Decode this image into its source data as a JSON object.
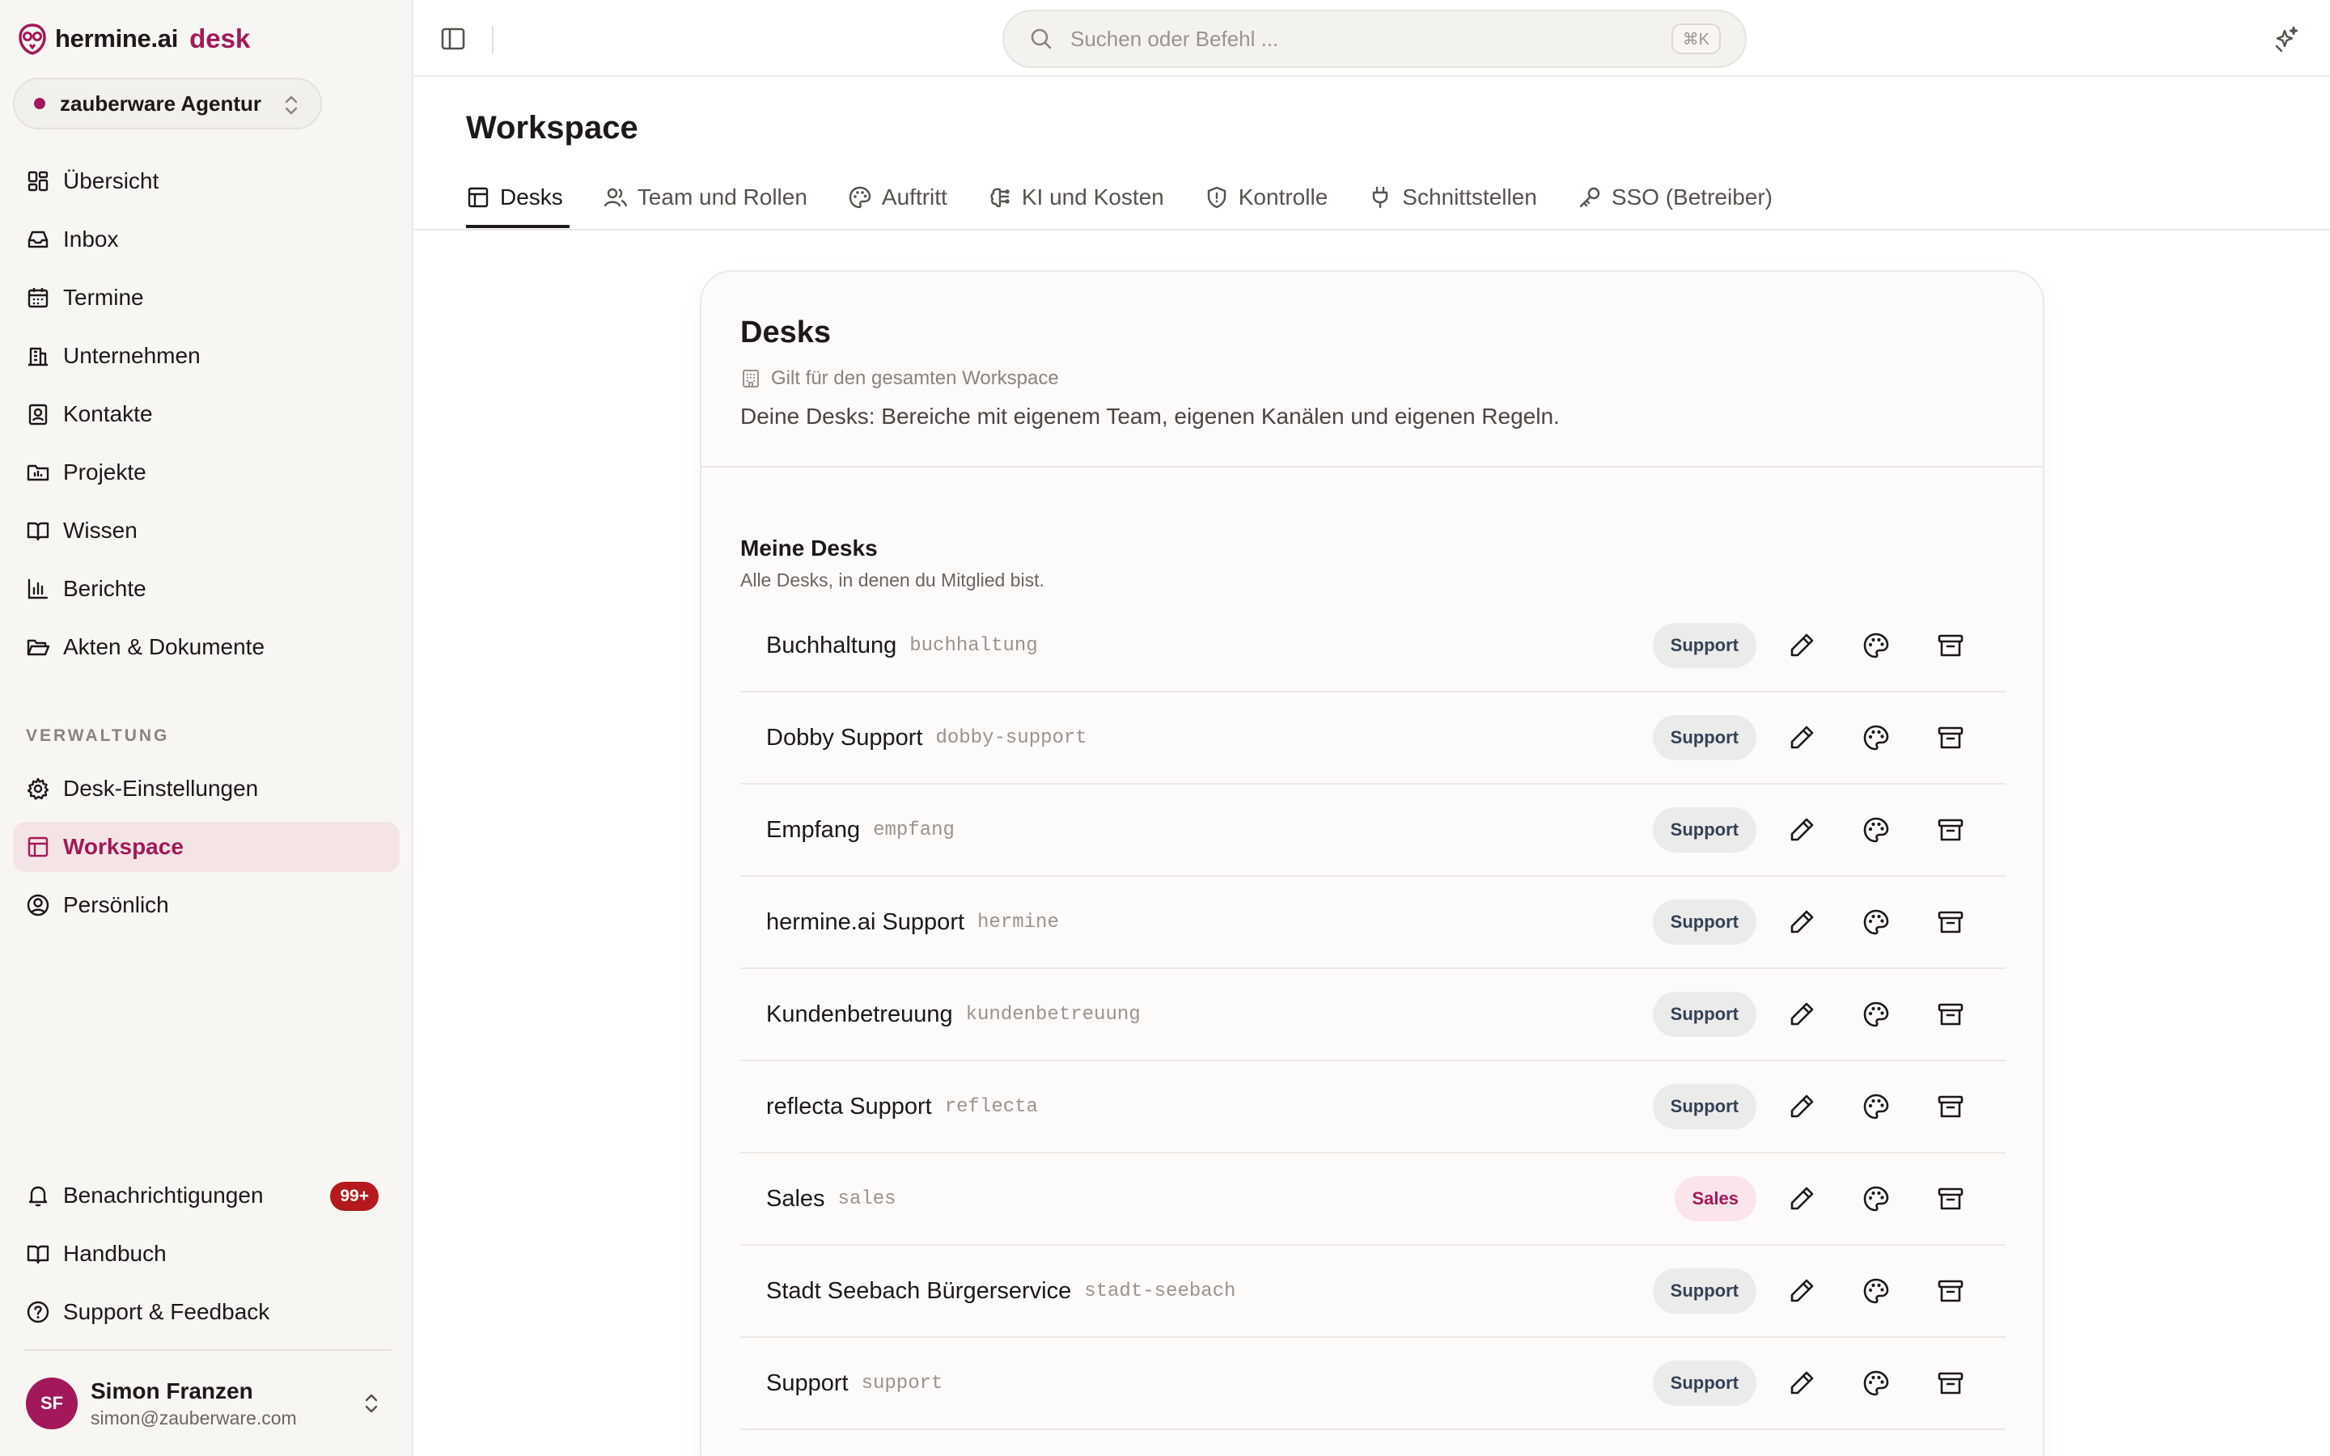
{
  "brand": {
    "name": "hermine.ai",
    "product": "desk"
  },
  "workspace_switcher": {
    "name": "zauberware Agentur"
  },
  "nav": {
    "main": [
      {
        "label": "Übersicht",
        "icon": "dashboard-icon"
      },
      {
        "label": "Inbox",
        "icon": "inbox-icon"
      },
      {
        "label": "Termine",
        "icon": "calendar-icon"
      },
      {
        "label": "Unternehmen",
        "icon": "building-icon"
      },
      {
        "label": "Kontakte",
        "icon": "contact-icon"
      },
      {
        "label": "Projekte",
        "icon": "folder-chart-icon"
      },
      {
        "label": "Wissen",
        "icon": "book-icon"
      },
      {
        "label": "Berichte",
        "icon": "bar-chart-icon"
      },
      {
        "label": "Akten & Dokumente",
        "icon": "folder-open-icon"
      }
    ],
    "admin_section_label": "VERWALTUNG",
    "admin": [
      {
        "label": "Desk-Einstellungen",
        "icon": "gear-icon"
      },
      {
        "label": "Workspace",
        "icon": "layout-icon",
        "active": true
      },
      {
        "label": "Persönlich",
        "icon": "user-circle-icon"
      }
    ],
    "footer": [
      {
        "label": "Benachrichtigungen",
        "icon": "bell-icon",
        "badge": "99+"
      },
      {
        "label": "Handbuch",
        "icon": "book-icon"
      },
      {
        "label": "Support & Feedback",
        "icon": "help-circle-icon"
      }
    ]
  },
  "user": {
    "initials": "SF",
    "name": "Simon Franzen",
    "email": "simon@zauberware.com"
  },
  "search": {
    "placeholder": "Suchen oder Befehl ...",
    "shortcut": "⌘K"
  },
  "page": {
    "title": "Workspace",
    "tabs": [
      {
        "label": "Desks",
        "icon": "layout-icon",
        "active": true
      },
      {
        "label": "Team und Rollen",
        "icon": "users-icon"
      },
      {
        "label": "Auftritt",
        "icon": "palette-icon"
      },
      {
        "label": "KI und Kosten",
        "icon": "brain-icon"
      },
      {
        "label": "Kontrolle",
        "icon": "shield-icon"
      },
      {
        "label": "Schnittstellen",
        "icon": "plug-icon"
      },
      {
        "label": "SSO (Betreiber)",
        "icon": "key-icon"
      }
    ]
  },
  "card": {
    "title": "Desks",
    "scope": "Gilt für den gesamten Workspace",
    "description": "Deine Desks: Bereiche mit eigenem Team, eigenen Kanälen und eigenen Regeln.",
    "section_title": "Meine Desks",
    "section_subtitle": "Alle Desks, in denen du Mitglied bist.",
    "desks": [
      {
        "name": "Buchhaltung",
        "slug": "buchhaltung",
        "type": "Support"
      },
      {
        "name": "Dobby Support",
        "slug": "dobby-support",
        "type": "Support"
      },
      {
        "name": "Empfang",
        "slug": "empfang",
        "type": "Support"
      },
      {
        "name": "hermine.ai Support",
        "slug": "hermine",
        "type": "Support"
      },
      {
        "name": "Kundenbetreuung",
        "slug": "kundenbetreuung",
        "type": "Support"
      },
      {
        "name": "reflecta Support",
        "slug": "reflecta",
        "type": "Support"
      },
      {
        "name": "Sales",
        "slug": "sales",
        "type": "Sales"
      },
      {
        "name": "Stadt Seebach Bürgerservice",
        "slug": "stadt-seebach",
        "type": "Support"
      },
      {
        "name": "Support",
        "slug": "support",
        "type": "Support"
      }
    ]
  },
  "colors": {
    "accent": "#a3185a",
    "active_nav_bg": "#f5e4e6",
    "notification_badge": "#b3191d",
    "support_badge_bg": "#ebebea",
    "sales_badge_bg": "#fbe5ea"
  }
}
